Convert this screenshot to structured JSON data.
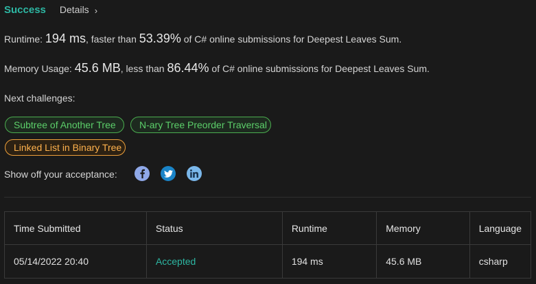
{
  "header": {
    "status": "Success",
    "details_label": "Details",
    "chevron": "›"
  },
  "runtime": {
    "prefix": "Runtime: ",
    "value": "194 ms",
    "middle": ", faster than ",
    "percent": "53.39%",
    "suffix": " of C# online submissions for Deepest Leaves Sum."
  },
  "memory": {
    "prefix": "Memory Usage: ",
    "value": "45.6 MB",
    "middle": ", less than ",
    "percent": "86.44%",
    "suffix": " of C# online submissions for Deepest Leaves Sum."
  },
  "challenges": {
    "label": "Next challenges:",
    "items": [
      {
        "label": "Subtree of Another Tree",
        "color": "#5ccf6a"
      },
      {
        "label": "N-ary Tree Preorder Traversal",
        "color": "#5ccf6a"
      },
      {
        "label": "Linked List in Binary Tree",
        "color": "#ffb24d"
      }
    ]
  },
  "share": {
    "label": "Show off your acceptance:",
    "icons": [
      "facebook-icon",
      "twitter-icon",
      "linkedin-icon"
    ]
  },
  "table": {
    "headers": [
      "Time Submitted",
      "Status",
      "Runtime",
      "Memory",
      "Language"
    ],
    "rows": [
      [
        "05/14/2022 20:40",
        "Accepted",
        "194 ms",
        "45.6 MB",
        "csharp"
      ]
    ]
  },
  "colors": {
    "accent": "#2db7a3",
    "easy": "#5ccf6a",
    "medium": "#ffb24d",
    "background": "#1a1a1a"
  }
}
